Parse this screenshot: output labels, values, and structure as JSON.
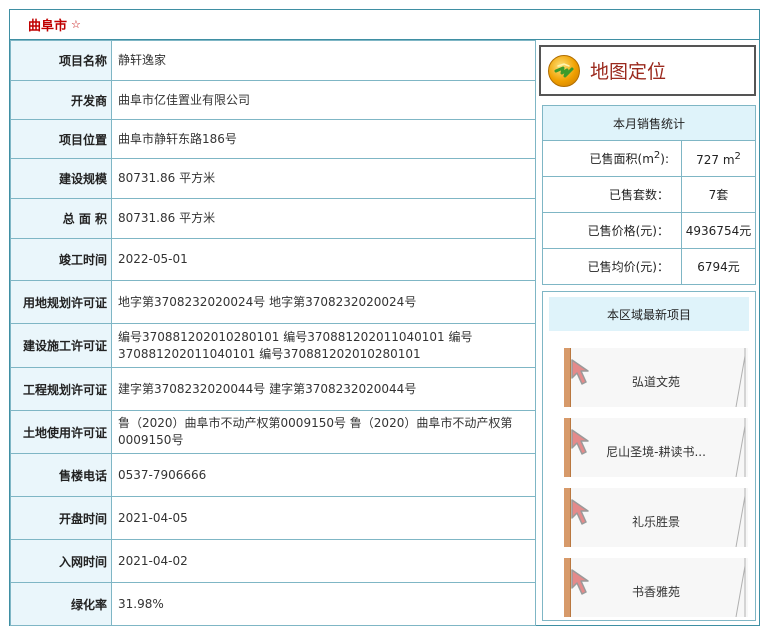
{
  "header": {
    "title": "曲阜市",
    "star": "☆"
  },
  "info": [
    {
      "label": "项目名称",
      "value": "静轩逸家"
    },
    {
      "label": "开发商",
      "value": "曲阜市亿佳置业有限公司"
    },
    {
      "label": "项目位置",
      "value": "曲阜市静轩东路186号"
    },
    {
      "label": "建设规模",
      "value": "80731.86 平方米"
    },
    {
      "label": "总 面 积",
      "value": "80731.86 平方米"
    },
    {
      "label": "竣工时间",
      "value": "2022-05-01"
    },
    {
      "label": "用地规划许可证",
      "value": "地字第3708232020024号 地字第3708232020024号"
    },
    {
      "label": "建设施工许可证",
      "value": "编号370881202010280101 编号370881202011040101 编号370881202011040101 编号370881202010280101"
    },
    {
      "label": "工程规划许可证",
      "value": "建字第3708232020044号 建字第3708232020044号"
    },
    {
      "label": "土地使用许可证",
      "value": "鲁（2020）曲阜市不动产权第0009150号 鲁（2020）曲阜市不动产权第0009150号"
    },
    {
      "label": "售楼电话",
      "value": "0537-7906666"
    },
    {
      "label": "开盘时间",
      "value": "2021-04-05"
    },
    {
      "label": "入网时间",
      "value": "2021-04-02"
    },
    {
      "label": "绿化率",
      "value": "31.98%"
    }
  ],
  "map_button": {
    "label": "地图定位",
    "icon": "globe-icon"
  },
  "sales": {
    "title": "本月销售统计",
    "area_label": "已售面积(m",
    "area_sup": "2",
    "area_label_end": "):",
    "area_value": "727 m",
    "area_value_sup": "2",
    "units_label": "已售套数：",
    "units_value": "7套",
    "price_label": "已售价格(元)：",
    "price_value": "4936754元",
    "avg_label": "已售均价(元)：",
    "avg_value": "6794元"
  },
  "projects": {
    "title": "本区域最新项目",
    "items": [
      {
        "name": "弘道文苑"
      },
      {
        "name": "尼山圣境-耕读书..."
      },
      {
        "name": "礼乐胜景"
      },
      {
        "name": "书香雅苑"
      }
    ]
  },
  "colors": {
    "border": "#3f8fa3",
    "label_bg": "#eaf6fb",
    "title": "#c00000",
    "map_text": "#9b2a1e"
  }
}
